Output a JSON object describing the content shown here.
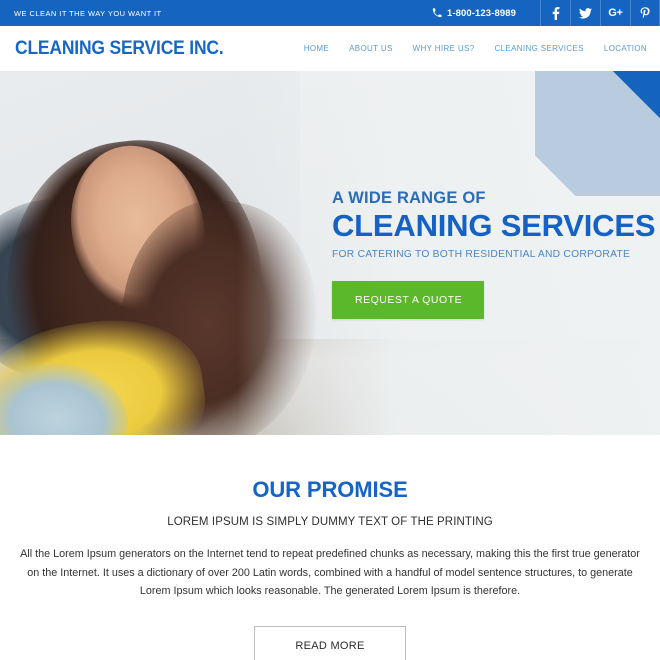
{
  "topbar": {
    "tagline": "WE CLEAN IT THE WAY YOU WANT IT",
    "phone": "1-800-123-8989",
    "phone_icon": "phone-icon",
    "social": [
      {
        "name": "facebook-icon",
        "label": "f"
      },
      {
        "name": "twitter-icon",
        "label": "t"
      },
      {
        "name": "google-plus-icon",
        "label": "G+"
      },
      {
        "name": "pinterest-icon",
        "label": "P"
      }
    ],
    "bg_color": "#1565c0"
  },
  "header": {
    "logo": "CLEANING SERVICE INC.",
    "logo_color": "#1668c4",
    "nav": [
      {
        "label": "HOME"
      },
      {
        "label": "ABOUT US"
      },
      {
        "label": "WHY HIRE US?"
      },
      {
        "label": "CLEANING SERVICES"
      },
      {
        "label": "LOCATION"
      }
    ],
    "nav_color": "#5b9bd5"
  },
  "hero": {
    "kicker": "A WIDE RANGE OF",
    "title": "CLEANING SERVICES",
    "subtitle": "FOR CATERING TO BOTH RESIDENTIAL AND CORPORATE",
    "cta_label": "REQUEST A QUOTE",
    "cta_color": "#5cb82b",
    "title_color": "#1561c4",
    "corner_accent_color": "#1464bd",
    "corner_band_color": "#b9cbdf",
    "image_alt": "Woman in yellow rubber glove wiping a counter with a blue cloth"
  },
  "promise": {
    "title": "OUR PROMISE",
    "title_color": "#1664c6",
    "subtitle": "LOREM IPSUM IS SIMPLY DUMMY TEXT OF THE PRINTING",
    "body": "All the Lorem Ipsum generators on the Internet tend to repeat predefined chunks as necessary, making this the first true generator on the Internet. It uses a dictionary of over 200 Latin words, combined with a handful of model sentence structures, to generate Lorem Ipsum which looks reasonable. The generated Lorem Ipsum is therefore.",
    "read_more_label": "READ MORE"
  }
}
